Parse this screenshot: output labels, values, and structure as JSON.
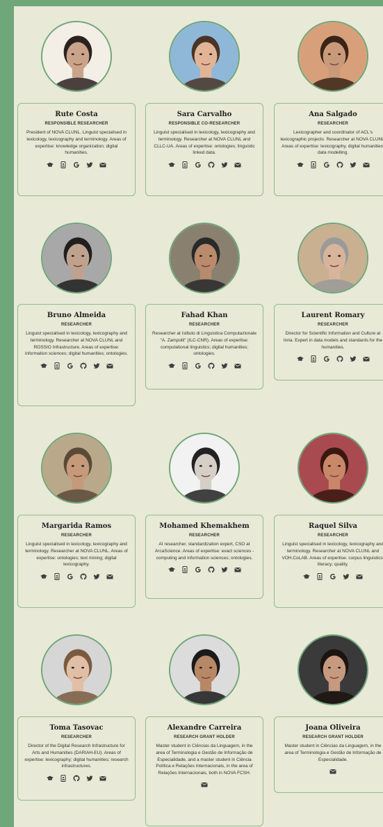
{
  "colors": {
    "accent": "#6fa67a",
    "card_border": "#8fbc8f",
    "background": "#e8e9d6",
    "icon": "#3d3d3d"
  },
  "members": [
    {
      "name": "Rute Costa",
      "role": "RESPONSIBLE RESEARCHER",
      "bio": "President of NOVA CLUNL. Linguist specialised in lexicology, lexicography and terminology. Areas of expertise: knowledge organization; digital humanities.",
      "icons": [
        "graduation-cap-icon",
        "id-card-icon",
        "google-icon",
        "twitter-icon",
        "envelope-icon"
      ]
    },
    {
      "name": "Sara Carvalho",
      "role": "RESPONSIBLE CO-RESEARCHER",
      "bio": "Linguist specialised in lexicology, lexicography and terminology. Researcher at NOVA CLUNL and CLLC-UA. Areas of expertise: ontologies; linguistic linked data.",
      "icons": [
        "graduation-cap-icon",
        "id-card-icon",
        "google-icon",
        "github-icon",
        "twitter-icon",
        "envelope-icon"
      ]
    },
    {
      "name": "Ana Salgado",
      "role": "RESEARCHER",
      "bio": "Lexicographer and coordinator of ACL's lexicographic projects. Researcher at NOVA CLUNL. Areas of expertise: lexicography, digital humanities; data modelling.",
      "icons": [
        "graduation-cap-icon",
        "id-card-icon",
        "google-icon",
        "github-icon",
        "twitter-icon",
        "envelope-icon"
      ]
    },
    {
      "name": "Bruno Almeida",
      "role": "RESEARCHER",
      "bio": "Linguist specialised in lexicology, lexicography and terminology. Researcher at NOVA CLUNL and ROSSIO Infrastructure. Areas of expertise: information sciences; digital humanities; ontologies.",
      "icons": [
        "graduation-cap-icon",
        "id-card-icon",
        "google-icon",
        "github-icon",
        "twitter-icon",
        "envelope-icon"
      ]
    },
    {
      "name": "Fahad Khan",
      "role": "RESEARCHER",
      "bio": "Researcher at Istituto di Linguistica Computazionale \"A. Zampolli\" (ILC-CNR). Areas of expertise: computational linguistics; digital humanities; ontologies.",
      "icons": [
        "graduation-cap-icon",
        "id-card-icon",
        "google-icon",
        "github-icon",
        "twitter-icon",
        "envelope-icon"
      ]
    },
    {
      "name": "Laurent Romary",
      "role": "RESEARCHER",
      "bio": "Director for Scientific Information and Culture at Inria. Expert in data models and standards for the humanities.",
      "icons": [
        "graduation-cap-icon",
        "id-card-icon",
        "google-icon",
        "github-icon",
        "twitter-icon",
        "envelope-icon"
      ]
    },
    {
      "name": "Margarida Ramos",
      "role": "RESEARCHER",
      "bio": "Linguist specialised in lexicology, lexicography and terminology. Researcher at NOVA CLUNL. Areas of expertise: ontologies; text mining; digital lexicography.",
      "icons": [
        "graduation-cap-icon",
        "id-card-icon",
        "google-icon",
        "github-icon",
        "twitter-icon",
        "envelope-icon"
      ]
    },
    {
      "name": "Mohamed Khemakhem",
      "role": "RESEARCHER",
      "bio": "AI researcher, standardization expert, CSO at ArcaScience. Areas of expertise: exact sciences - computing and information sciences; ontologies.",
      "icons": [
        "graduation-cap-icon",
        "id-card-icon",
        "google-icon",
        "github-icon",
        "twitter-icon",
        "envelope-icon"
      ]
    },
    {
      "name": "Raquel Silva",
      "role": "RESEARCHER",
      "bio": "Linguist specialised in lexicology, lexicography and terminology. Researcher at NOVA CLUNL and VOH.CoLAB. Areas of expertise: corpus linguistics, literacy; quality.",
      "icons": [
        "graduation-cap-icon",
        "id-card-icon",
        "google-icon",
        "twitter-icon",
        "envelope-icon"
      ]
    },
    {
      "name": "Toma Tasovac",
      "role": "RESEARCHER",
      "bio": "Director of the Digital Research Infrastructure for Arts and Humanities (DARIAH-EU). Areas of expertise: lexicography; digital humanities; research infrastructures.",
      "icons": [
        "graduation-cap-icon",
        "id-card-icon",
        "github-icon",
        "twitter-icon",
        "envelope-icon"
      ]
    },
    {
      "name": "Alexandre Carreira",
      "role": "RESEARCH GRANT HOLDER",
      "bio": "Master student in Ciências da Linguagem, in the area of Terminologia e Gestão de Informação de Especialidade, and a master student in Ciência Política e Relações Internacionais, in the area of Relações Internacionais, both in NOVA FCSH.",
      "icons": [
        "envelope-icon"
      ]
    },
    {
      "name": "Joana Oliveira",
      "role": "RESEARCH GRANT HOLDER",
      "bio": "Master student in Ciências da Linguagem, in the area of Terminologia e Gestão de Informação de Especialidade.",
      "icons": [
        "envelope-icon"
      ]
    }
  ]
}
